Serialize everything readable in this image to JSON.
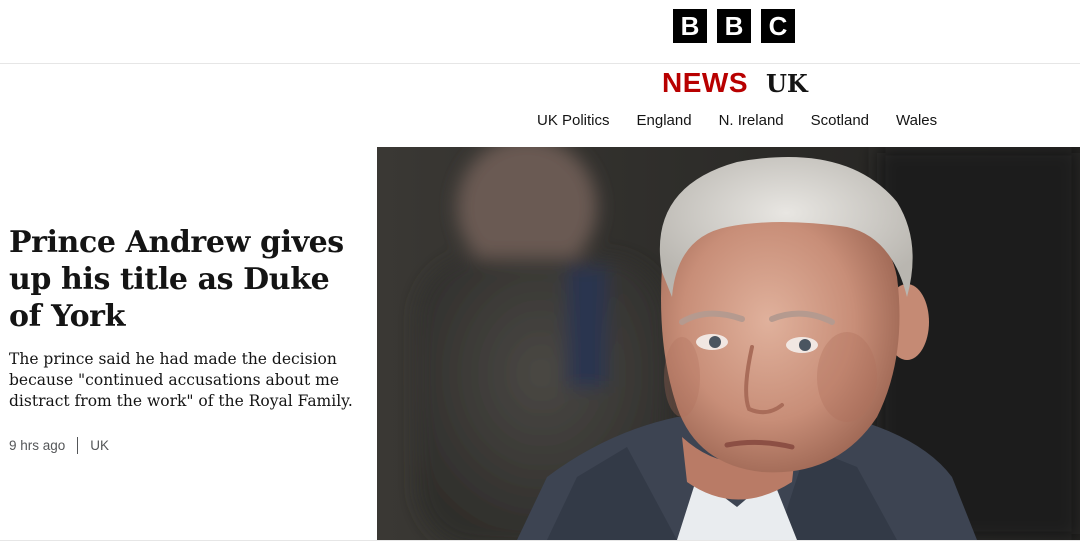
{
  "header": {
    "logo_letters": [
      "B",
      "B",
      "C"
    ],
    "section_label": "NEWS",
    "region_label": "UK",
    "brand_color": "#b80000"
  },
  "nav": {
    "items": [
      {
        "label": "UK Politics"
      },
      {
        "label": "England"
      },
      {
        "label": "N. Ireland"
      },
      {
        "label": "Scotland"
      },
      {
        "label": "Wales"
      }
    ]
  },
  "story": {
    "headline": "Prince Andrew gives up his title as Duke of York",
    "summary": "The prince said he had made the decision because \"continued accusations about me distract from the work\" of the Royal Family.",
    "time": "9 hrs ago",
    "topic": "UK"
  }
}
